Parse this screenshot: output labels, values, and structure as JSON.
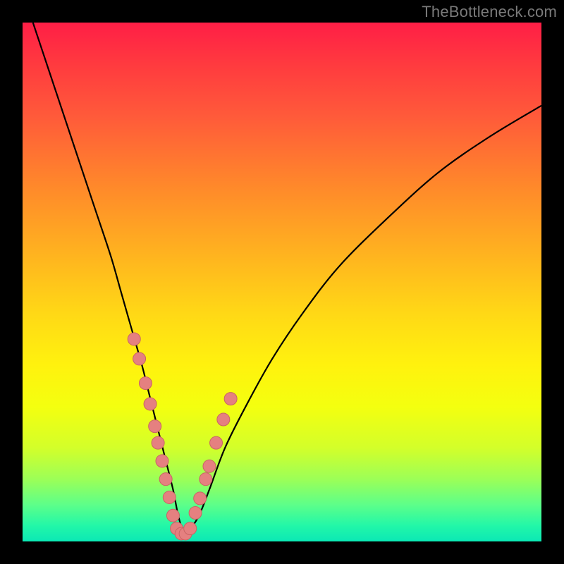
{
  "watermark": "TheBottleneck.com",
  "colors": {
    "frame": "#000000",
    "curve": "#000000",
    "dot_fill": "#e58080",
    "dot_stroke": "#c86464"
  },
  "chart_data": {
    "type": "line",
    "title": "",
    "xlabel": "",
    "ylabel": "",
    "xlim": [
      0,
      100
    ],
    "ylim": [
      0,
      100
    ],
    "grid": false,
    "series": [
      {
        "name": "bottleneck-curve",
        "x": [
          2,
          5,
          8,
          11,
          14,
          17,
          19,
          21,
          23,
          24.5,
          26,
          27.5,
          29,
          30,
          31,
          32,
          34,
          36,
          39,
          43,
          48,
          54,
          61,
          70,
          80,
          90,
          100
        ],
        "y": [
          100,
          91,
          82,
          73,
          64,
          55,
          48,
          41,
          34,
          28,
          22,
          16,
          10,
          5,
          2,
          2,
          5,
          10,
          18,
          26,
          35,
          44,
          53,
          62,
          71,
          78,
          84
        ]
      }
    ],
    "dots": {
      "name": "highlighted-points",
      "x": [
        21.5,
        22.5,
        23.7,
        24.6,
        25.5,
        26.1,
        26.9,
        27.6,
        28.3,
        29.0,
        29.7,
        30.6,
        31.4,
        32.3,
        33.3,
        34.2,
        35.3,
        36.0,
        37.3,
        38.7,
        40.1
      ],
      "y": [
        39.0,
        35.2,
        30.5,
        26.5,
        22.2,
        19.0,
        15.5,
        12.0,
        8.5,
        5.0,
        2.5,
        1.5,
        1.5,
        2.5,
        5.5,
        8.3,
        12.0,
        14.5,
        19.0,
        23.5,
        27.5
      ]
    }
  }
}
